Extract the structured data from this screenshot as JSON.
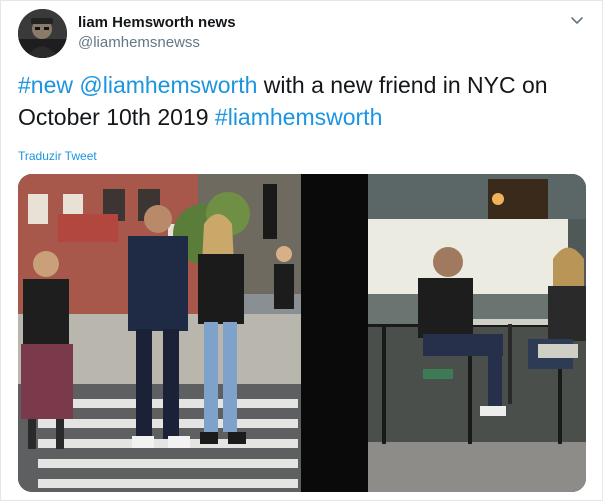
{
  "tweet": {
    "author": {
      "display_name": "liam Hemsworth news",
      "handle": "@liamhemsnewss",
      "avatar_icon": "avatar-photo-icon"
    },
    "text_parts": [
      {
        "text": "#new",
        "link": true
      },
      {
        "text": " ",
        "link": false
      },
      {
        "text": "@liamhemsworth",
        "link": true
      },
      {
        "text": " with a new friend in NYC on October 10th 2019 ",
        "link": false
      },
      {
        "text": "#liamhemsworth",
        "link": true
      }
    ],
    "translate_label": "Traduzir Tweet",
    "menu_icon": "chevron-down-icon",
    "media": {
      "left_photo_icon": "street-photo-icon",
      "right_photo_icon": "cafe-photo-icon"
    }
  },
  "colors": {
    "link": "#1b95e0",
    "text": "#14171a",
    "secondary": "#657786",
    "border": "#e1e8ed"
  }
}
